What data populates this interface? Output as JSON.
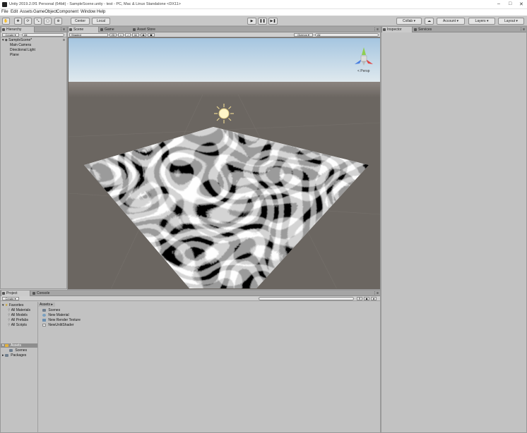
{
  "window": {
    "title": "Unity 2019.2.0f1 Personal (64bit) - SampleScene.unity - test - PC, Mac & Linux Standalone <DX11>",
    "controls": [
      "–",
      "□",
      "✕"
    ]
  },
  "menubar": [
    "File",
    "Edit",
    "Assets",
    "GameObject",
    "Component",
    "Window",
    "Help"
  ],
  "toolbar": {
    "tools": [
      "hand-icon",
      "move-icon",
      "rotate-icon",
      "scale-icon",
      "rect-icon",
      "transform-icon"
    ],
    "pivot_label": "Center",
    "space_label": "Local",
    "collab_label": "Collab ▾",
    "account_label": "Account ▾",
    "layers_label": "Layers ▾",
    "layout_label": "Layout ▾"
  },
  "hierarchy": {
    "tab_label": "Hierarchy",
    "create_label": "Create ▾",
    "search_placeholder": "All",
    "scene_name": "SampleScene*",
    "items": [
      "Main Camera",
      "Directional Light",
      "Plane"
    ]
  },
  "scene_panel": {
    "tabs": [
      "Scene",
      "Game",
      "Asset Store"
    ],
    "shading_mode": "Shaded",
    "mode_2d": "2D",
    "gizmos_label": "Gizmos ▾",
    "search_placeholder": "All",
    "gizmo_label": "< Persp"
  },
  "project_panel": {
    "tabs": [
      "Project",
      "Console"
    ],
    "create_label": "Create ▾",
    "favorites": {
      "label": "Favorites",
      "items": [
        "All Materials",
        "All Models",
        "All Prefabs",
        "All Scripts"
      ]
    },
    "breadcrumb": "Assets ▸",
    "assets": [
      {
        "name": "Scenes",
        "icon": "folder-icon"
      },
      {
        "name": "New Material",
        "icon": "material-icon"
      },
      {
        "name": "New Render Texture",
        "icon": "render-texture-icon"
      },
      {
        "name": "NewUnlitShader",
        "icon": "shader-icon"
      }
    ],
    "tree": {
      "root": "Assets",
      "children": [
        "Scenes"
      ],
      "packages": "Packages"
    }
  },
  "inspector": {
    "tabs": [
      "Inspector",
      "Services"
    ]
  },
  "colors": {
    "sky_top": "#a5c5e0",
    "sky_horizon": "#dfe9ee",
    "ground": "#6b6661",
    "panel_bg": "#c2c2c2",
    "folder": "#e3b13b"
  }
}
